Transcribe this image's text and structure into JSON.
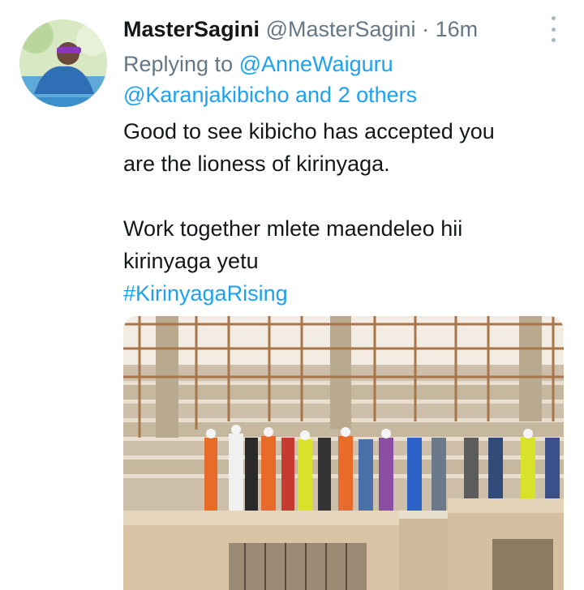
{
  "tweet": {
    "display_name": "MasterSagini",
    "handle": "@MasterSagini",
    "separator": "·",
    "time": "16m",
    "replying_prefix": "Replying to",
    "replying_to_primary": "@AnneWaiguru",
    "replying_to_secondary": "@Karanjakibicho and 2 others",
    "text_line_1": "Good to see kibicho has accepted you",
    "text_line_2": "are the lioness of kirinyaga.",
    "text_line_3": "Work together mlete maendeleo hii",
    "text_line_4": "kirinyaga yetu",
    "hashtag": "#KirinyagaRising"
  },
  "icons": {
    "more": "more-vertical-icon"
  },
  "colors": {
    "text": "#14171a",
    "muted": "#657786",
    "link": "#1da1f2",
    "background": "#ffffff"
  }
}
